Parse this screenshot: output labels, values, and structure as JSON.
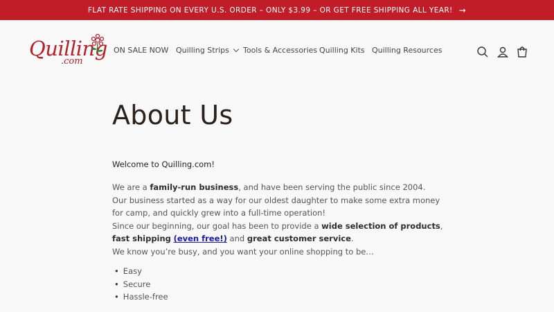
{
  "announcement": {
    "text": "FLAT RATE SHIPPING ON EVERY U.S. ORDER – ONLY $3.99 – OR GET FREE SHIPPING ALL YEAR!",
    "arrow": "→",
    "background": "#c11d28"
  },
  "logo": {
    "word": "Quilling",
    "suffix": ".com"
  },
  "nav": {
    "items": [
      {
        "label": "ON SALE NOW"
      },
      {
        "label": "Quilling Strips",
        "has_dropdown": true
      },
      {
        "label": "Tools & Accessories"
      },
      {
        "label": "Quilling Kits"
      },
      {
        "label": "Quilling Resources"
      }
    ]
  },
  "header_icons": [
    "search-icon",
    "account-icon",
    "cart-icon"
  ],
  "page": {
    "title": "About Us",
    "welcome": "Welcome to Quilling.com!",
    "p1_a": "We are a ",
    "p1_b": "family-run business",
    "p1_c": ", and have been serving the public since 2004.",
    "p2": "Our business started as a way for our oldest daughter to make some extra money for camp, and quickly grew into a full-time operation!",
    "p3_a": "Since our beginning, our goal has been to provide a ",
    "p3_b": "wide selection of products",
    "p3_c": ", ",
    "p3_d": "fast shipping",
    "p3_link": "(even free!)",
    "p3_e": " and ",
    "p3_f": "great customer service",
    "p3_g": ".",
    "p4": "We know you’re busy, and you want your online shopping to be…",
    "bullets": [
      "Easy",
      "Secure",
      "Hassle-free"
    ]
  }
}
